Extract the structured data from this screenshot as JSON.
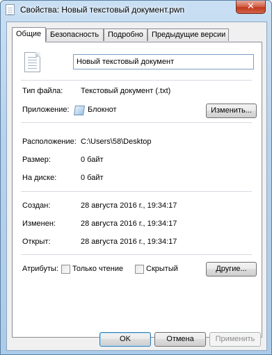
{
  "window": {
    "title": "Свойства: Новый текстовый документ.pwn",
    "close_label": "✕"
  },
  "tabs": [
    {
      "label": "Общие",
      "active": true
    },
    {
      "label": "Безопасность",
      "active": false
    },
    {
      "label": "Подробно",
      "active": false
    },
    {
      "label": "Предыдущие версии",
      "active": false
    }
  ],
  "general": {
    "file_name": "Новый текстовый документ",
    "file_type_label": "Тип файла:",
    "file_type_value": "Текстовый документ (.txt)",
    "app_label": "Приложение:",
    "app_value": "Блокнот",
    "change_button": "Изменить...",
    "location_label": "Расположение:",
    "location_value": "C:\\Users\\58\\Desktop",
    "size_label": "Размер:",
    "size_value": "0 байт",
    "disk_label": "На диске:",
    "disk_value": "0 байт",
    "created_label": "Создан:",
    "created_value": "28 августа 2016 г., 19:34:17",
    "modified_label": "Изменен:",
    "modified_value": "28 августа 2016 г., 19:34:17",
    "opened_label": "Открыт:",
    "opened_value": "28 августа 2016 г., 19:34:17",
    "attributes_label": "Атрибуты:",
    "readonly_label": "Только чтение",
    "readonly_checked": false,
    "hidden_label": "Скрытый",
    "hidden_checked": false,
    "other_button": "Другие..."
  },
  "footer": {
    "ok": "OK",
    "cancel": "Отмена",
    "apply": "Применить"
  },
  "icons": {
    "title": "text-file-icon",
    "file": "text-document-icon",
    "app": "notepad-icon"
  }
}
